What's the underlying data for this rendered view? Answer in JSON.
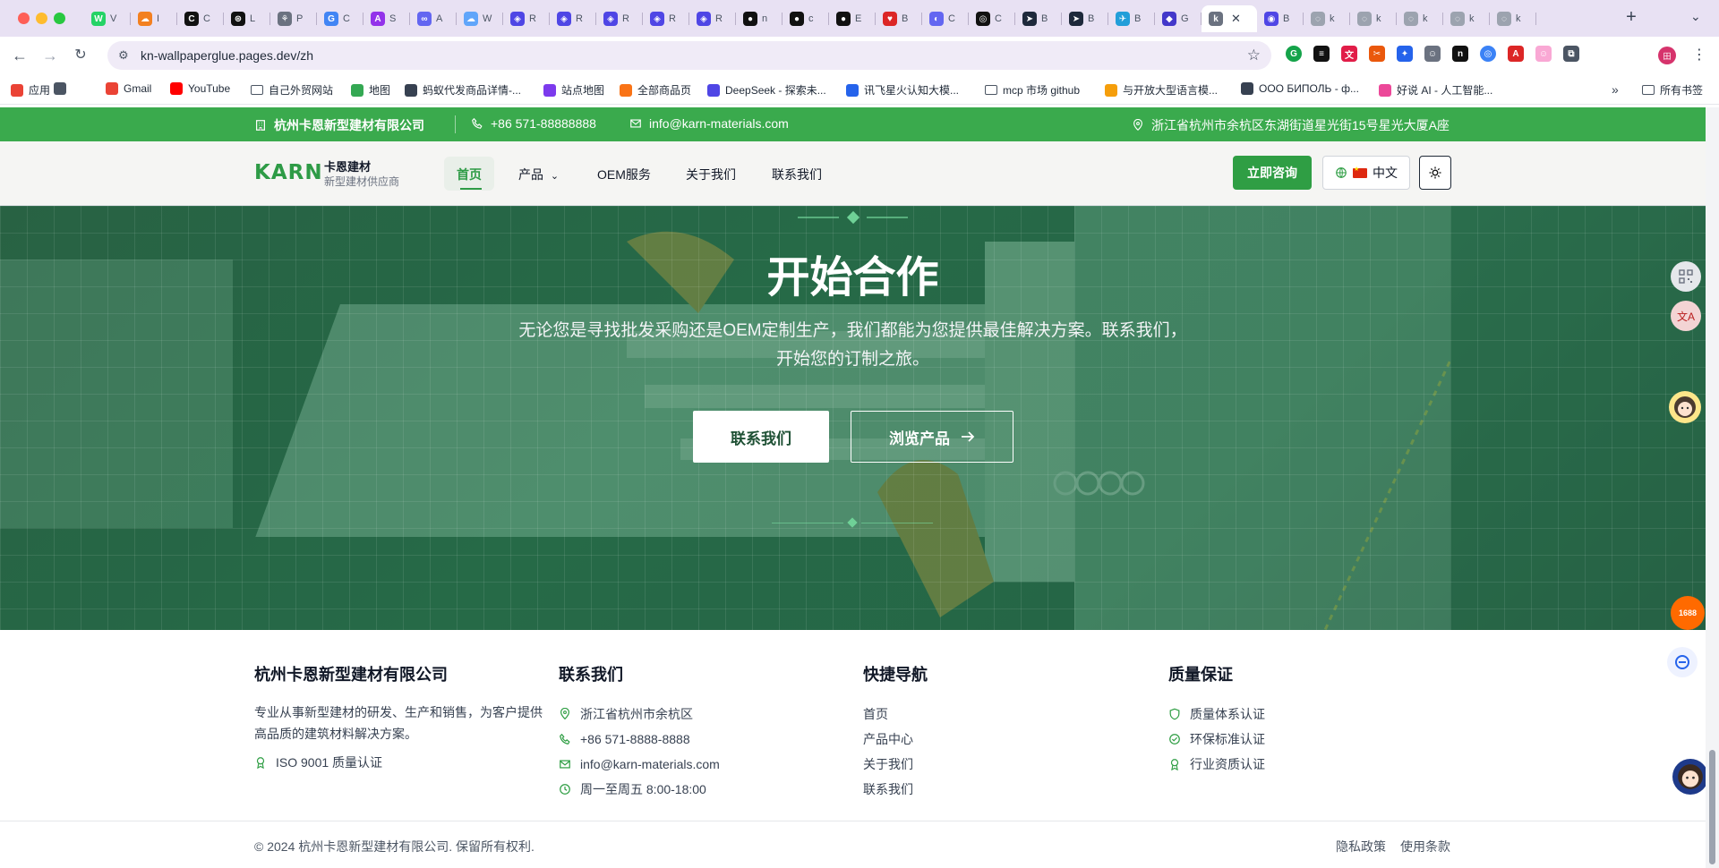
{
  "browser": {
    "tabs": [
      {
        "letter": "W",
        "color": "#25d366",
        "label": "V"
      },
      {
        "letter": "☁",
        "color": "#f38020",
        "label": "I"
      },
      {
        "letter": "C",
        "color": "#111111",
        "label": "C"
      },
      {
        "letter": "⊛",
        "color": "#111111",
        "label": "L"
      },
      {
        "letter": "⚘",
        "color": "#6b7280",
        "label": "P"
      },
      {
        "letter": "G",
        "color": "#4285f4",
        "label": "C"
      },
      {
        "letter": "A",
        "color": "#9333ea",
        "label": "S"
      },
      {
        "letter": "∞",
        "color": "#6366f1",
        "label": "A"
      },
      {
        "letter": "☁",
        "color": "#60a5fa",
        "label": "W"
      },
      {
        "letter": "◈",
        "color": "#4f46e5",
        "label": "R"
      },
      {
        "letter": "◈",
        "color": "#4f46e5",
        "label": "R"
      },
      {
        "letter": "◈",
        "color": "#4f46e5",
        "label": "R"
      },
      {
        "letter": "◈",
        "color": "#4f46e5",
        "label": "R"
      },
      {
        "letter": "◈",
        "color": "#4f46e5",
        "label": "R"
      },
      {
        "letter": "●",
        "color": "#111111",
        "label": "n"
      },
      {
        "letter": "●",
        "color": "#111111",
        "label": "c"
      },
      {
        "letter": "●",
        "color": "#111111",
        "label": "E"
      },
      {
        "letter": "♥",
        "color": "#dc2626",
        "label": "B"
      },
      {
        "letter": "◐",
        "color": "#6366f1",
        "label": "C"
      },
      {
        "letter": "◎",
        "color": "#111111",
        "label": "C"
      },
      {
        "letter": "➤",
        "color": "#1e293b",
        "label": "B"
      },
      {
        "letter": "➤",
        "color": "#1e293b",
        "label": "B"
      },
      {
        "letter": "✈",
        "color": "#229ed9",
        "label": "B"
      },
      {
        "letter": "◆",
        "color": "#4338ca",
        "label": "G"
      },
      {
        "letter": "◉",
        "color": "#4f46e5",
        "label": "B"
      },
      {
        "letter": "◌",
        "color": "#9ca3af",
        "label": "k"
      },
      {
        "letter": "◌",
        "color": "#9ca3af",
        "label": "k"
      },
      {
        "letter": "◌",
        "color": "#9ca3af",
        "label": "k"
      },
      {
        "letter": "◌",
        "color": "#9ca3af",
        "label": "k"
      },
      {
        "letter": "◌",
        "color": "#9ca3af",
        "label": "k"
      }
    ],
    "active_tab": {
      "letter": "k",
      "label": "k"
    },
    "url": "kn-wallpaperglue.pages.dev/zh",
    "bookmarks": [
      {
        "label": "应用",
        "icon": "apps-grid-icon"
      },
      {
        "label": "",
        "icon": "tab-groups-icon"
      },
      {
        "label": "Gmail",
        "icon": "gmail-icon"
      },
      {
        "label": "YouTube",
        "icon": "youtube-icon"
      },
      {
        "label": "自己外贸网站",
        "icon": "folder-icon"
      },
      {
        "label": "地图",
        "icon": "maps-icon"
      },
      {
        "label": "蚂蚁代发商品详情-...",
        "icon": "globe-icon"
      },
      {
        "label": "站点地图",
        "icon": "sitemap-icon"
      },
      {
        "label": "全部商品页",
        "icon": "shop-icon"
      },
      {
        "label": "DeepSeek - 探索未...",
        "icon": "deepseek-icon"
      },
      {
        "label": "讯飞星火认知大模...",
        "icon": "spark-icon"
      },
      {
        "label": "mcp 市场 github",
        "icon": "folder-icon"
      },
      {
        "label": "与开放大型语言模...",
        "icon": "layers-icon"
      },
      {
        "label": "ООО БИПОЛЬ - ф...",
        "icon": "globe-icon"
      },
      {
        "label": "好说 AI - 人工智能...",
        "icon": "ai-icon"
      }
    ],
    "all_bookmarks_label": "所有书签",
    "profile_initial": "田"
  },
  "topbar": {
    "company": "杭州卡恩新型建材有限公司",
    "phone": "+86 571-88888888",
    "email": "info@karn-materials.com",
    "address": "浙江省杭州市余杭区东湖街道星光街15号星光大厦A座",
    "bg_color": "#3aaa4d"
  },
  "header": {
    "logo": "KARN",
    "brand_name": "卡恩建材",
    "brand_sub": "新型建材供应商",
    "nav": [
      "首页",
      "产品",
      "OEM服务",
      "关于我们",
      "联系我们"
    ],
    "consult_label": "立即咨询",
    "lang_label": "中文",
    "accent": "#2f9e44"
  },
  "hero": {
    "title": "开始合作",
    "description": "无论您是寻找批发采购还是OEM定制生产，我们都能为您提供最佳解决方案。联系我们，开始您的订制之旅。",
    "contact_label": "联系我们",
    "browse_label": "浏览产品"
  },
  "footer": {
    "about": {
      "title": "杭州卡恩新型建材有限公司",
      "text": "专业从事新型建材的研发、生产和销售，为客户提供高品质的建筑材料解决方案。",
      "cert": "ISO 9001 质量认证"
    },
    "contact": {
      "title": "联系我们",
      "address": "浙江省杭州市余杭区",
      "phone": "+86 571-8888-8888",
      "email": "info@karn-materials.com",
      "hours": "周一至周五 8:00-18:00"
    },
    "quicknav": {
      "title": "快捷导航",
      "links": [
        "首页",
        "产品中心",
        "关于我们",
        "联系我们"
      ]
    },
    "quality": {
      "title": "质量保证",
      "items": [
        "质量体系认证",
        "环保标准认证",
        "行业资质认证"
      ]
    },
    "copyright": "© 2024 杭州卡恩新型建材有限公司. 保留所有权利.",
    "privacy": "隐私政策",
    "terms": "使用条款"
  },
  "side_widgets": {
    "alibaba_label": "1688"
  }
}
